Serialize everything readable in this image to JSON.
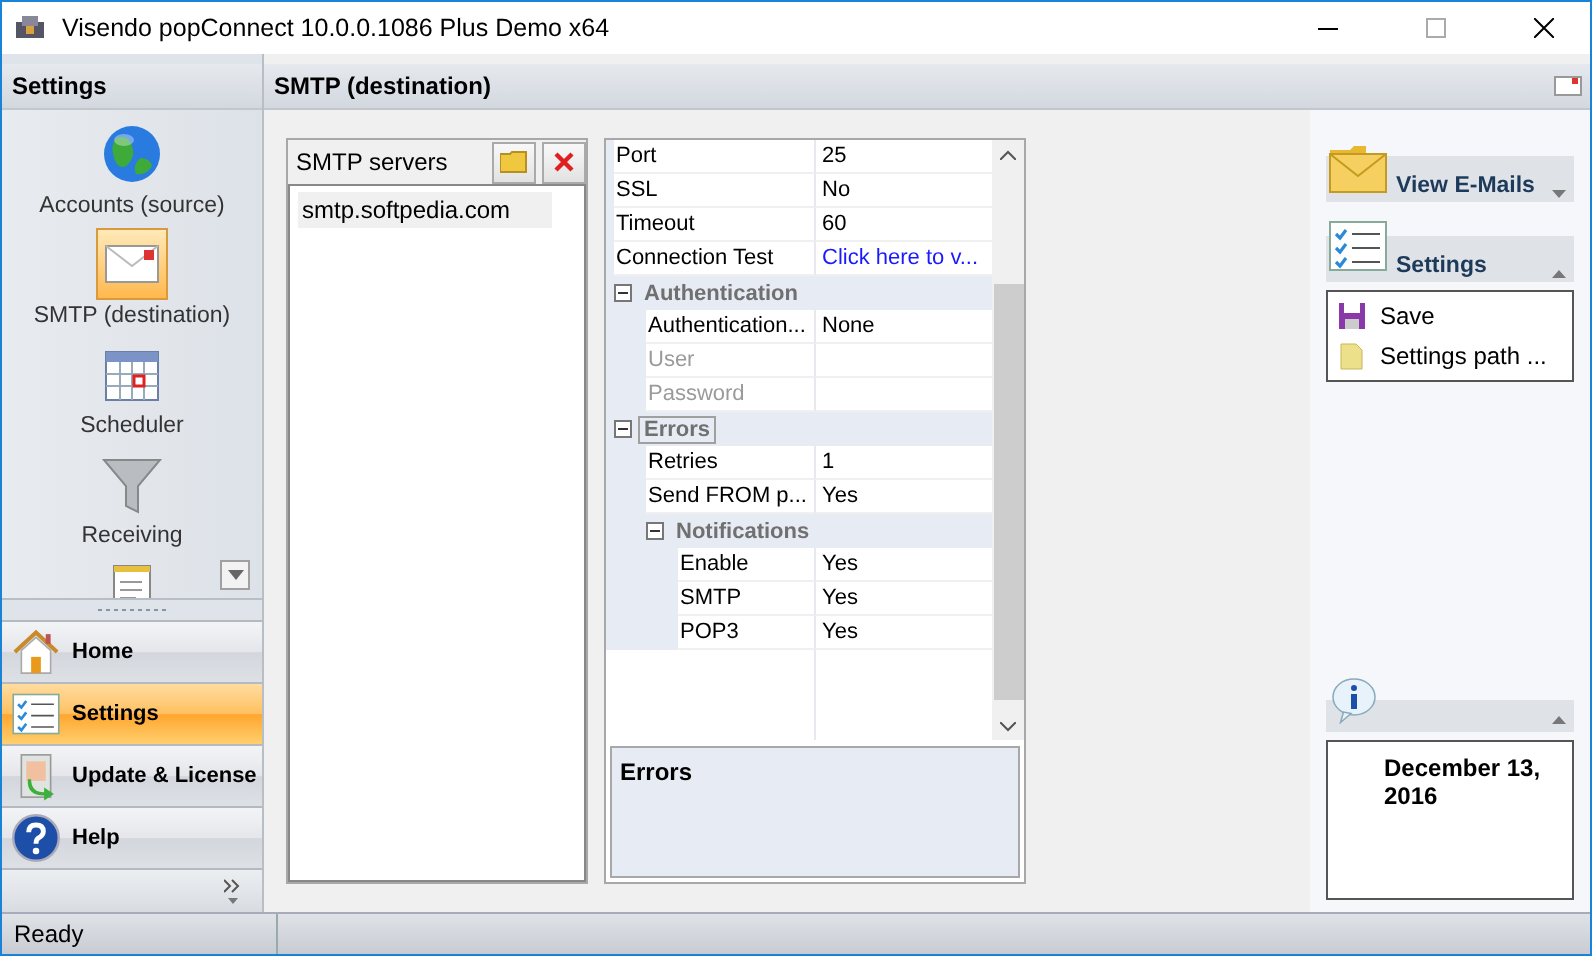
{
  "window": {
    "title": "Visendo popConnect 10.0.0.1086 Plus Demo x64"
  },
  "sidebar": {
    "title": "Settings",
    "items": [
      {
        "label": "Accounts (source)",
        "kind": "globe",
        "selected": false
      },
      {
        "label": "SMTP (destination)",
        "kind": "envelope",
        "selected": true
      },
      {
        "label": "Scheduler",
        "kind": "calendar",
        "selected": false
      },
      {
        "label": "Receiving",
        "kind": "funnel",
        "selected": false
      }
    ],
    "nav": [
      {
        "label": "Home",
        "kind": "house",
        "selected": false
      },
      {
        "label": "Settings",
        "kind": "checklist",
        "selected": true
      },
      {
        "label": "Update & License",
        "kind": "update",
        "selected": false
      },
      {
        "label": "Help",
        "kind": "help",
        "selected": false
      }
    ]
  },
  "page_title": "SMTP (destination)",
  "servers": {
    "title": "SMTP servers",
    "items": [
      {
        "label": "smtp.softpedia.com",
        "selected": true
      }
    ]
  },
  "properties": [
    {
      "kind": "property",
      "name": "Port",
      "value": "25",
      "disabled": false,
      "selected": false
    },
    {
      "kind": "property",
      "name": "SSL",
      "value": "No",
      "disabled": false,
      "selected": false
    },
    {
      "kind": "property",
      "name": "Timeout",
      "value": "60",
      "disabled": false,
      "selected": false
    },
    {
      "kind": "link",
      "name": "Connection Test",
      "value": "Click here to v...",
      "disabled": false,
      "selected": false
    },
    {
      "kind": "category",
      "name": "Authentication",
      "expanded": true,
      "selected": false,
      "children": [
        {
          "kind": "property",
          "name": "Authentication...",
          "value": "None",
          "disabled": false,
          "selected": false
        },
        {
          "kind": "property",
          "name": "User",
          "disabled": true,
          "selected": false
        },
        {
          "kind": "property",
          "name": "Password",
          "disabled": true,
          "selected": false
        }
      ]
    },
    {
      "kind": "category",
      "name": "Errors",
      "expanded": true,
      "selected": true,
      "children": [
        {
          "kind": "property",
          "name": "Retries",
          "value": "1",
          "disabled": false,
          "selected": false
        },
        {
          "kind": "property",
          "name": "Send FROM p...",
          "value": "Yes",
          "disabled": false,
          "selected": false
        },
        {
          "kind": "category",
          "name": "Notifications",
          "expanded": true,
          "selected": false,
          "children": [
            {
              "kind": "property",
              "name": "Enable",
              "value": "Yes",
              "disabled": false,
              "selected": false
            },
            {
              "kind": "property",
              "name": "SMTP",
              "value": "Yes",
              "disabled": false,
              "selected": false
            },
            {
              "kind": "property",
              "name": "POP3",
              "value": "Yes",
              "disabled": false,
              "selected": false
            }
          ]
        }
      ]
    }
  ],
  "description": {
    "title": "Errors"
  },
  "right_panel": {
    "groups": [
      {
        "label": "View E-Mails",
        "kind": "mail",
        "expanded": false
      },
      {
        "label": "Settings",
        "kind": "checklist",
        "expanded": true,
        "items": [
          {
            "label": "Save",
            "kind": "floppy"
          },
          {
            "label": "Settings path ...",
            "kind": "folder"
          }
        ]
      }
    ],
    "info": {
      "expanded": true,
      "text": "December 13, 2016"
    }
  },
  "status_bar": {
    "text": "Ready"
  }
}
